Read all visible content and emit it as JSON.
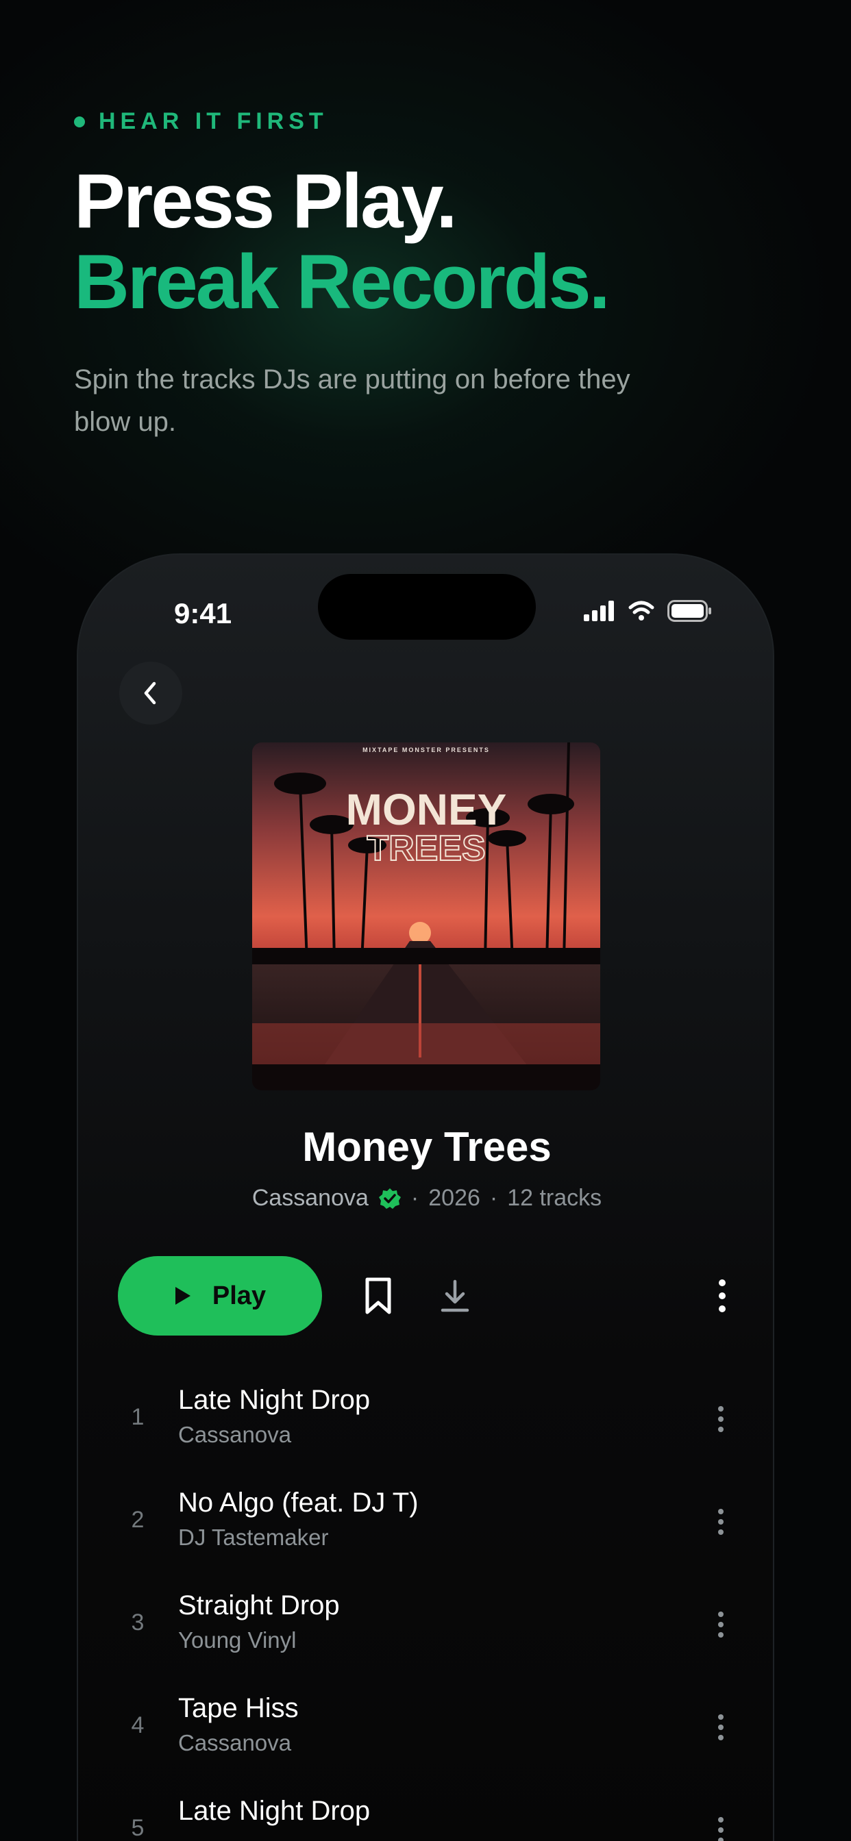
{
  "hero": {
    "eyebrow": "HEAR IT FIRST",
    "headline_line1": "Press Play.",
    "headline_line2": "Break Records.",
    "subtitle": "Spin the tracks DJs are putting on before they blow up."
  },
  "status_bar": {
    "time": "9:41",
    "icons": [
      "cellular-signal-icon",
      "wifi-icon",
      "battery-icon"
    ]
  },
  "album": {
    "cover_top_text": "MIXTAPE MONSTER PRESENTS",
    "cover_title_line1": "MONEY",
    "cover_title_line2": "TREES",
    "title": "Money Trees",
    "artist": "Cassanova",
    "verified": true,
    "year": "2026",
    "track_count": "12 tracks"
  },
  "actions": {
    "play_label": "Play",
    "icons": [
      "play-icon",
      "bookmark-icon",
      "download-icon",
      "more-icon"
    ]
  },
  "tracks": [
    {
      "number": "1",
      "title": "Late Night Drop",
      "artist": "Cassanova"
    },
    {
      "number": "2",
      "title": "No Algo (feat. DJ T)",
      "artist": "DJ Tastemaker"
    },
    {
      "number": "3",
      "title": "Straight Drop",
      "artist": "Young Vinyl"
    },
    {
      "number": "4",
      "title": "Tape Hiss",
      "artist": "Cassanova"
    },
    {
      "number": "5",
      "title": "Late Night Drop",
      "artist": ""
    }
  ],
  "colors": {
    "accent_green": "#19b97d",
    "play_button": "#1fbf5a",
    "background": "#050607"
  }
}
